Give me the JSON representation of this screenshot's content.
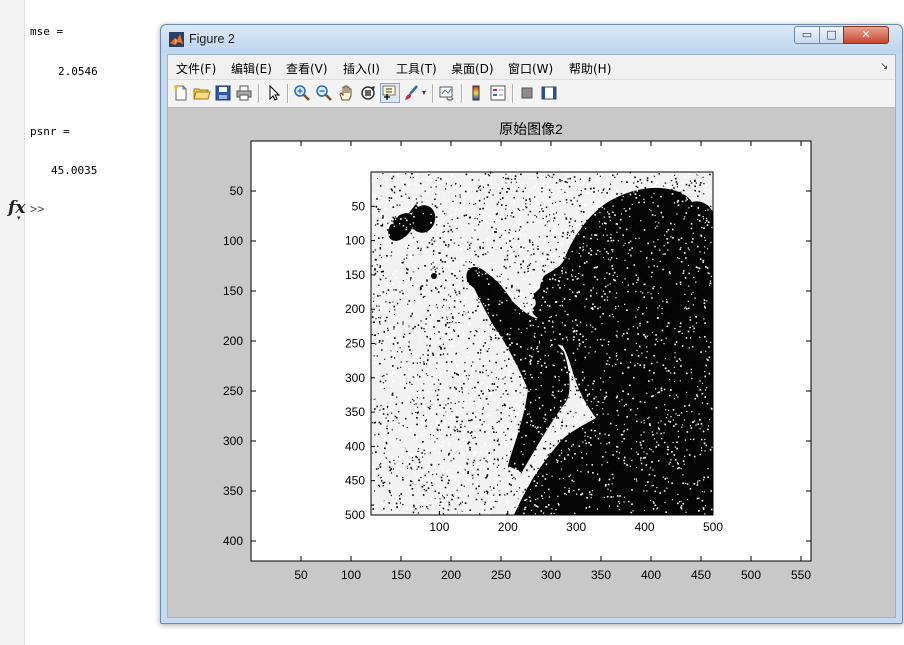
{
  "command_window": {
    "lines": [
      {
        "text": "mse ="
      },
      {
        "text": "2.0546"
      },
      {
        "text": "psnr ="
      },
      {
        "text": "45.0035"
      }
    ],
    "prompt": ">>",
    "fx_label": "fx"
  },
  "figure": {
    "title": "Figure 2",
    "window_buttons": {
      "minimize": "▭",
      "maximize": "□",
      "close": "✕"
    },
    "menu": [
      "文件(F)",
      "编辑(E)",
      "查看(V)",
      "插入(I)",
      "工具(T)",
      "桌面(D)",
      "窗口(W)",
      "帮助(H)"
    ],
    "dock_arrow": "↘",
    "toolbar_icons": [
      "new-figure-icon",
      "open-file-icon",
      "save-icon",
      "print-icon",
      "edit-plot-arrow-icon",
      "zoom-in-icon",
      "zoom-out-icon",
      "pan-hand-icon",
      "rotate-3d-icon",
      "data-cursor-icon",
      "brush-icon",
      "link-plot-icon",
      "colorbar-icon",
      "legend-icon",
      "hide-plot-tools-icon",
      "show-plot-tools-icon"
    ],
    "axes_title": "原始图像2"
  },
  "chart_data": {
    "type": "image",
    "title": "原始图像2",
    "outer_axes": {
      "xlim": [
        0,
        560
      ],
      "ylim": [
        0,
        420
      ],
      "y_reversed": true,
      "x_ticks": [
        "50",
        "100",
        "150",
        "200",
        "250",
        "300",
        "350",
        "400",
        "450",
        "500",
        "550"
      ],
      "y_ticks": [
        "50",
        "100",
        "150",
        "200",
        "250",
        "300",
        "350",
        "400"
      ]
    },
    "image_axes": {
      "xlim": [
        0,
        500
      ],
      "ylim": [
        0,
        500
      ],
      "y_reversed": true,
      "x_ticks": [
        "100",
        "200",
        "300",
        "400",
        "500"
      ],
      "y_ticks": [
        "50",
        "100",
        "150",
        "200",
        "250",
        "300",
        "350",
        "400",
        "450",
        "500"
      ]
    },
    "colors": {
      "background": "#c8c8c8",
      "axes": "#ffffff",
      "ink": "#000000",
      "paper": "#f2f2f2"
    }
  }
}
